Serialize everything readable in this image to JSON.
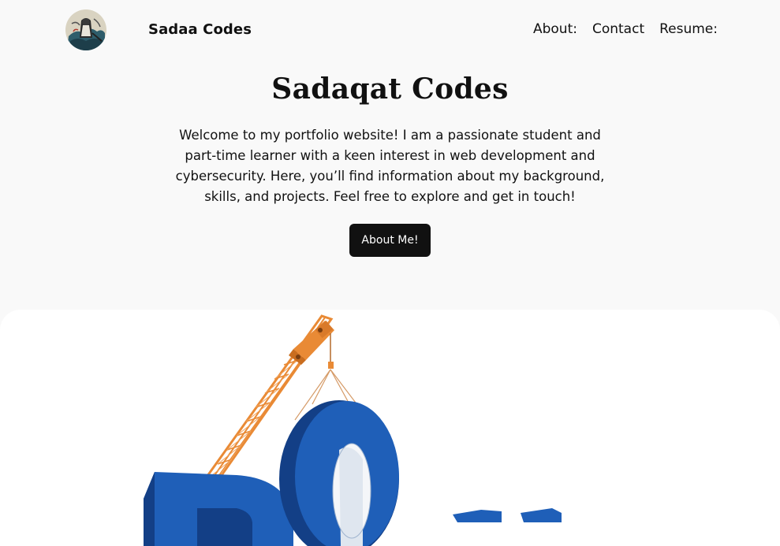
{
  "header": {
    "logo_alt": "Sadaa Codes logo",
    "site_title": "Sadaa Codes",
    "nav": [
      {
        "label": "About:"
      },
      {
        "label": "Contact"
      },
      {
        "label": "Resume:"
      }
    ]
  },
  "hero": {
    "title": "Sadaqat Codes",
    "intro": "Welcome to my portfolio website! I am a passionate student and part-time learner with a keen interest in web development and cybersecurity. Here, you’ll find information about my background, skills, and projects. Feel free to explore and get in touch!",
    "cta_label": "About Me!"
  },
  "media": {
    "icon": "construction-crane-illustration",
    "colors": {
      "crane": "#e98a35",
      "letters": "#1f5fb8",
      "letters_dark": "#133f86"
    }
  }
}
